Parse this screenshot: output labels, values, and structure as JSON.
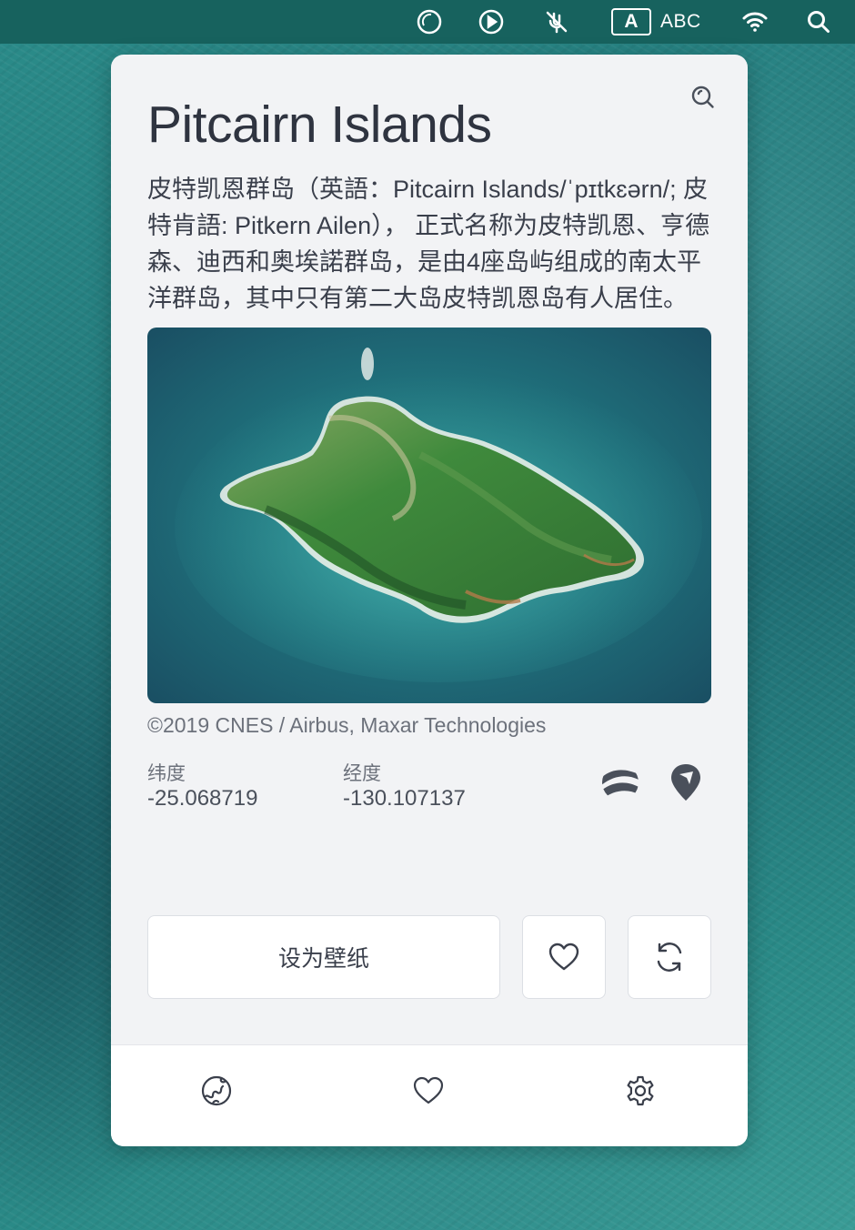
{
  "menubar": {
    "input_indicator": "A",
    "input_source": "ABC",
    "icons": [
      "loop-icon",
      "play-icon",
      "muted-mic-icon",
      "input-source-icon",
      "wifi-icon",
      "search-icon"
    ]
  },
  "location": {
    "title": "Pitcairn Islands",
    "description": "皮特凯恩群岛（英語：Pitcairn Islands/ˈpɪtkɛərn/; 皮特肯語: Pitkern Ailen）， 正式名称为皮特凯恩、亨德森、迪西和奥埃諾群岛，是由4座岛屿组成的南太平洋群岛，其中只有第二大岛皮特凯恩岛有人居住。",
    "credit": "©2019 CNES / Airbus, Maxar Technologies",
    "latitude_label": "纬度",
    "latitude": "-25.068719",
    "longitude_label": "经度",
    "longitude": "-130.107137"
  },
  "actions": {
    "set_wallpaper": "设为壁纸"
  },
  "tabs": [
    "explore-globe-icon",
    "favorites-heart-icon",
    "settings-gear-icon"
  ],
  "colors": {
    "menubar_bg": "#17625e",
    "panel_bg": "#f2f3f5",
    "text_primary": "#2f3440",
    "text_secondary": "#6c717b"
  }
}
